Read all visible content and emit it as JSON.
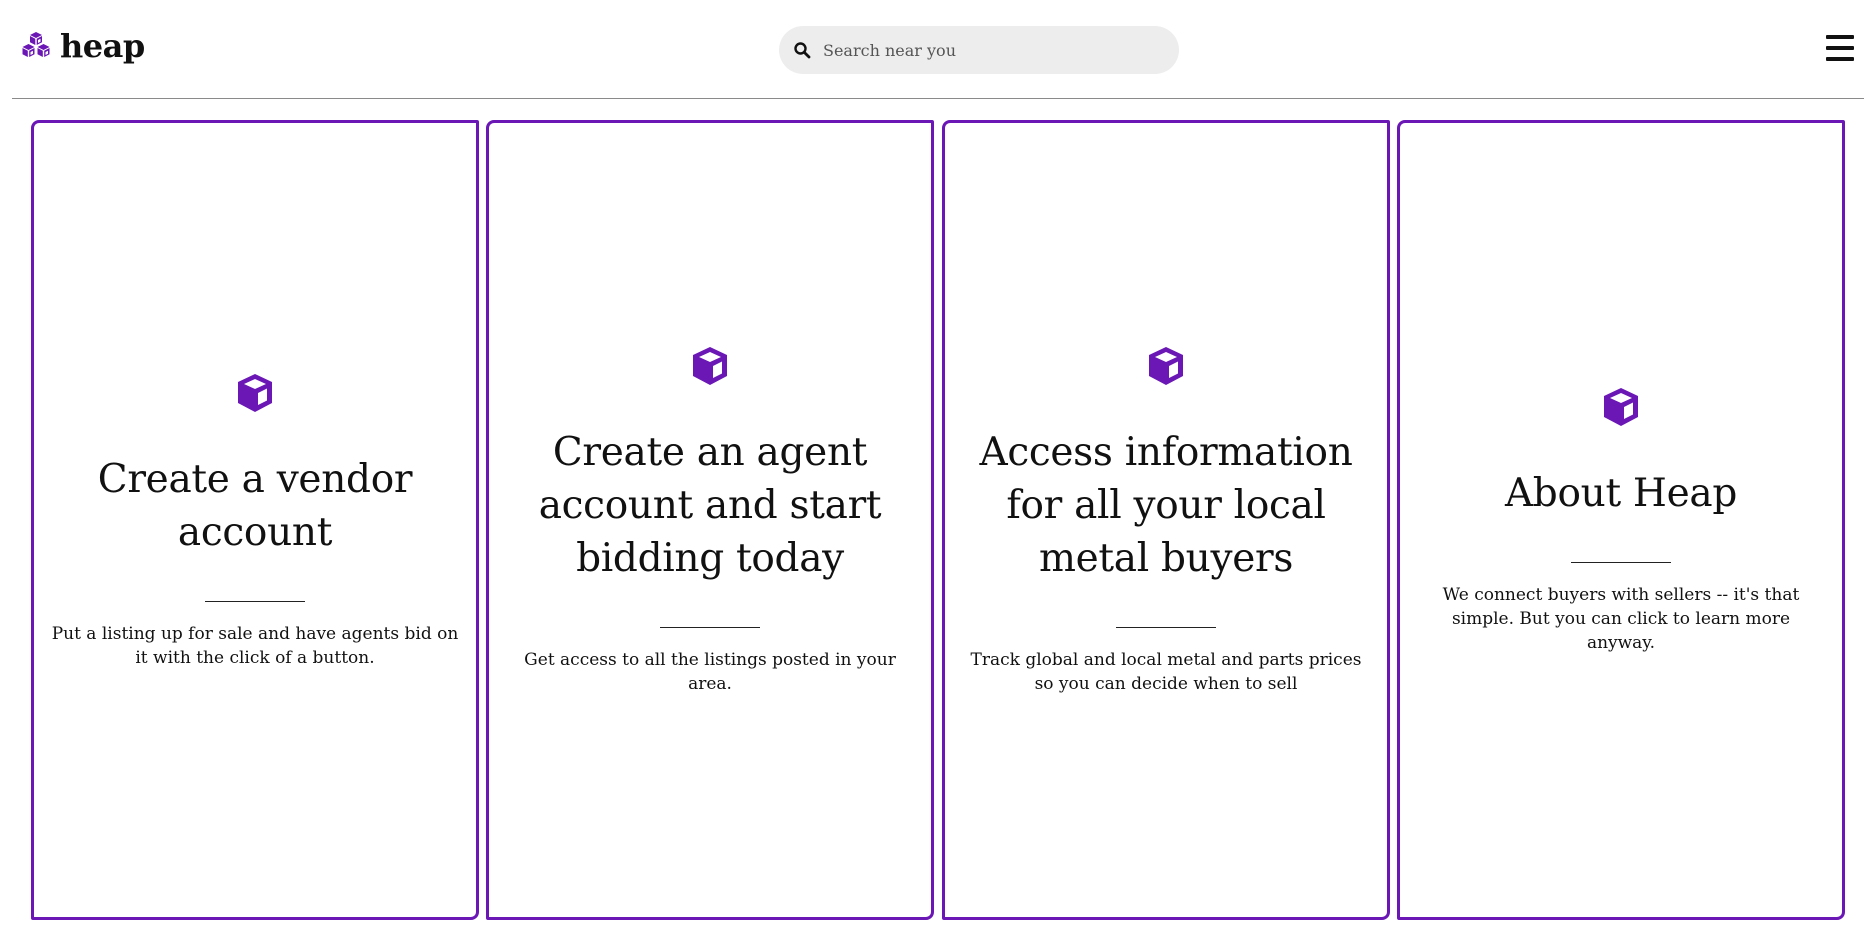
{
  "app": {
    "name": "heap",
    "logo_icon": "cubes-icon",
    "brand_color": "#6a17b6"
  },
  "header": {
    "search": {
      "placeholder": "Search near you",
      "value": "",
      "icon": "search-icon"
    },
    "menu_icon": "hamburger-menu-icon"
  },
  "cards": [
    {
      "icon": "cube-icon",
      "title": "Create a vendor account",
      "description": "Put a listing up for sale and have agents bid on it with the click of a button."
    },
    {
      "icon": "cube-icon",
      "title": "Create an agent account and start bidding today",
      "description": "Get access to all the listings posted in your area."
    },
    {
      "icon": "cube-icon",
      "title": "Access information for all your local metal buyers",
      "description": "Track global and local metal and parts prices so you can decide when to sell"
    },
    {
      "icon": "cube-icon",
      "title": "About Heap",
      "description": "We connect buyers with sellers -- it's that simple. But you can click to learn more anyway."
    }
  ]
}
